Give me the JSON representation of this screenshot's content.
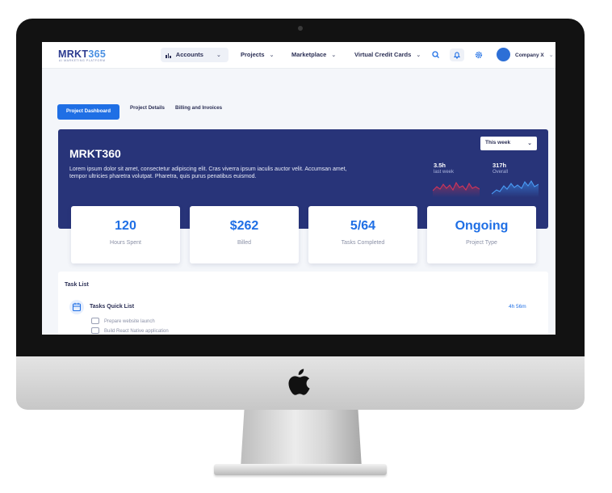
{
  "brand": {
    "name_main": "MRKT",
    "name_accent": "365",
    "tagline": "AI MARKETING PLATFORM"
  },
  "nav": {
    "items": [
      {
        "label": "Accounts",
        "active": true
      },
      {
        "label": "Projects"
      },
      {
        "label": "Marketplace"
      },
      {
        "label": "Virtual Credit Cards"
      }
    ],
    "icons": [
      "search-icon",
      "bell-icon",
      "gear-icon"
    ],
    "company": "Company X"
  },
  "tabs": [
    {
      "label": "Project Dashboard",
      "active": true
    },
    {
      "label": "Project Details"
    },
    {
      "label": "Billing and Invoices"
    }
  ],
  "banner": {
    "title": "MRKT360",
    "description": "Lorem ipsum dolor sit amet, consectetur adipiscing elit. Cras viverra ipsum iaculis auctor velit. Accumsan amet, tempor ultricies pharetra volutpat. Pharetra, quis purus penatibus euismod.",
    "period_select": "This week",
    "stats": [
      {
        "value": "3.5h",
        "caption": "last week"
      },
      {
        "value": "317h",
        "caption": "Overall"
      }
    ]
  },
  "metrics": [
    {
      "value": "120",
      "caption": "Hours Spent"
    },
    {
      "value": "$262",
      "caption": "Billed"
    },
    {
      "value": "5/64",
      "caption": "Tasks Completed"
    },
    {
      "value": "Ongoing",
      "caption": "Project Type"
    }
  ],
  "task_list": {
    "title": "Task List",
    "quick_list_title": "Tasks Quick List",
    "quick_list_time": "4h 56m",
    "tasks": [
      {
        "label": "Prepare website launch"
      },
      {
        "label": "Build React Native application"
      }
    ]
  },
  "colors": {
    "primary": "#1f6fe5",
    "banner": "#283479",
    "spark_red": "#c0304f",
    "spark_blue": "#3b8ff0"
  }
}
